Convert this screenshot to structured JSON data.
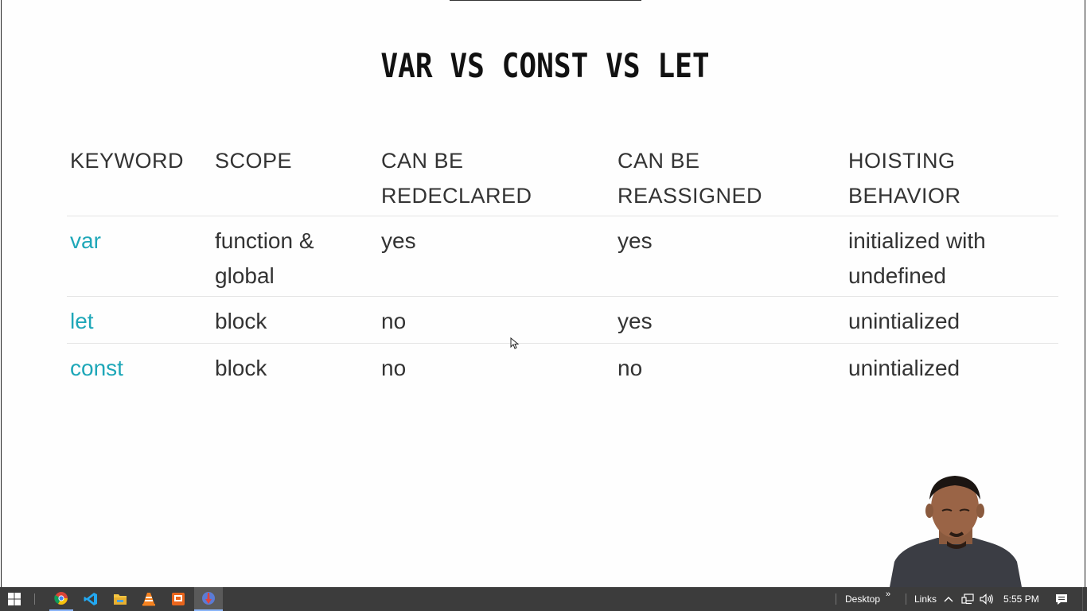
{
  "slide": {
    "title": "VAR VS CONST VS LET",
    "table": {
      "headers": [
        "KEYWORD",
        "SCOPE",
        "CAN BE\nREDECLARED",
        "CAN BE\nREASSIGNED",
        "HOISTING\nBEHAVIOR"
      ],
      "rows": [
        [
          "var",
          "function &\nglobal",
          "yes",
          "yes",
          "initialized with\nundefined"
        ],
        [
          "let",
          "block",
          "no",
          "yes",
          "unintialized"
        ],
        [
          "const",
          "block",
          "no",
          "no",
          "unintialized"
        ]
      ]
    },
    "keyword_color": "#1ea7b8"
  },
  "taskbar": {
    "pinned_icons": [
      "windows-start-icon",
      "chrome-icon",
      "vscode-icon",
      "file-explorer-icon",
      "vlc-icon",
      "slides-app-icon",
      "recorder-app-icon"
    ],
    "desktop_label": "Desktop",
    "links_label": "Links",
    "time": "5:55 PM",
    "chevron": "»"
  }
}
